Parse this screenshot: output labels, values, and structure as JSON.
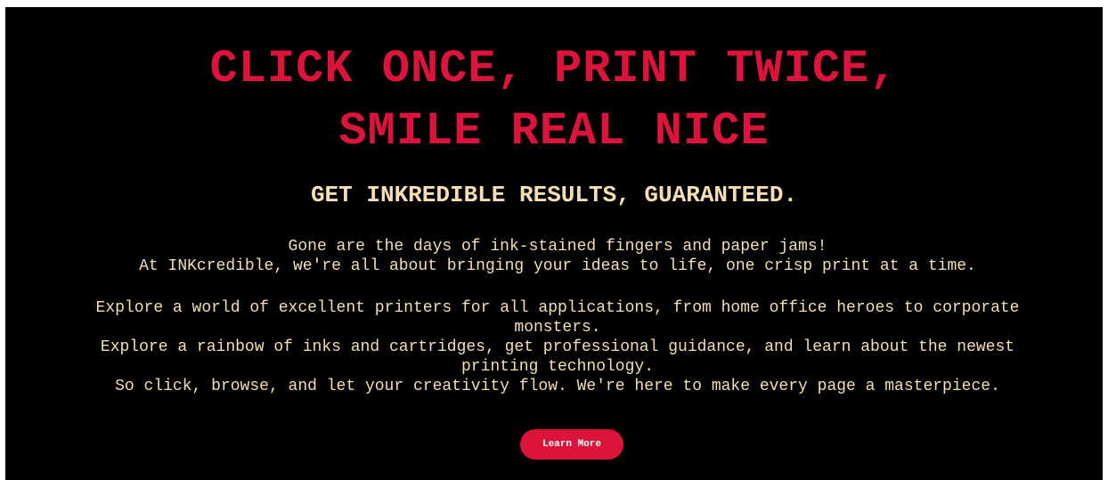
{
  "hero": {
    "headline_line1": "CLICK ONCE, PRINT TWICE,",
    "headline_line2": "SMILE REAL NICE",
    "subheadline": "GET INKREDIBLE RESULTS, GUARANTEED.",
    "intro_line1": "Gone are the days of ink-stained fingers and paper jams!",
    "intro_line2": "At INKcredible, we're all about bringing your ideas to life, one crisp print at a time.",
    "paragraph1": "Explore a world of excellent printers for all applications, from home office heroes to corporate monsters.",
    "paragraph2": "Explore a rainbow of inks and cartridges, get professional guidance, and learn about the newest printing technology.",
    "paragraph3": "So click, browse, and let your creativity flow. We're here to make every page a masterpiece.",
    "button_label": "Learn More"
  },
  "colors": {
    "background": "#000000",
    "accent": "#dc143c",
    "text": "#f5deb3",
    "button_text": "#ffffff"
  }
}
